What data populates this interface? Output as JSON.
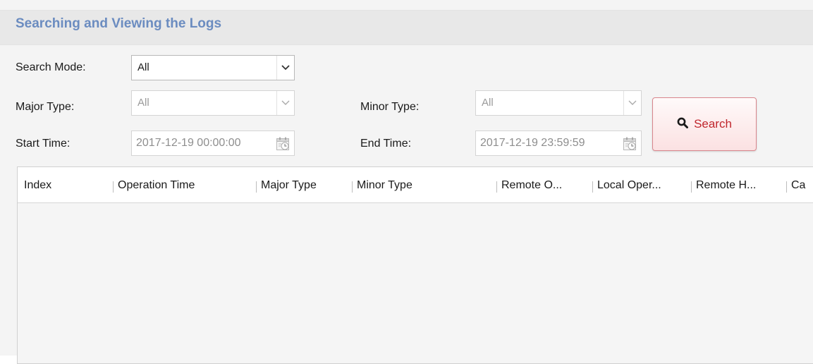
{
  "panel": {
    "title": "Searching and Viewing the Logs"
  },
  "filters": {
    "search_mode": {
      "label": "Search Mode:",
      "value": "All"
    },
    "major_type": {
      "label": "Major Type:",
      "value": "All"
    },
    "minor_type": {
      "label": "Minor Type:",
      "value": "All"
    },
    "start_time": {
      "label": "Start Time:",
      "value": "2017-12-19 00:00:00"
    },
    "end_time": {
      "label": "End Time:",
      "value": "2017-12-19 23:59:59"
    }
  },
  "search_button": {
    "label": "Search",
    "icon": "search-icon"
  },
  "table": {
    "columns": [
      "Index",
      "Operation Time",
      "Major Type",
      "Minor Type",
      "Remote O...",
      "Local Oper...",
      "Remote H...",
      "Ca"
    ],
    "rows": []
  },
  "colors": {
    "title_text": "#6b8cc0",
    "search_text": "#c0262d",
    "search_border": "#d9868d"
  }
}
